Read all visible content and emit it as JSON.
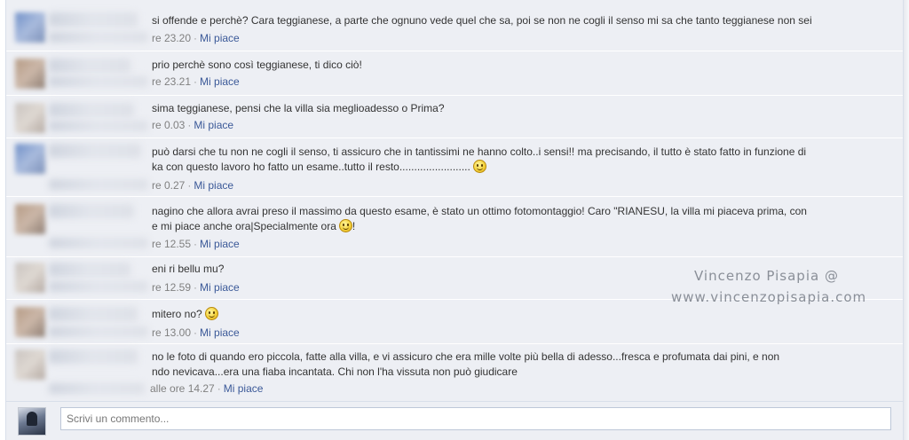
{
  "comments": [
    {
      "text_lines": [
        "si offende e perchè? Cara teggianese, a parte che ognuno vede quel che sa, poi se non ne cogli il senso mi sa che tanto teggianese non sei"
      ],
      "time": "re 23.20",
      "like": "Mi piace"
    },
    {
      "text_lines": [
        "prio perchè sono così teggianese, ti dico ciò!"
      ],
      "time": "re 23.21",
      "like": "Mi piace"
    },
    {
      "text_lines": [
        "sima teggianese, pensi che la villa sia meglioadesso o Prima?"
      ],
      "time": "re 0.03",
      "like": "Mi piace"
    },
    {
      "text_lines": [
        "può darsi che tu non ne cogli il senso, ti assicuro che in tantissimi ne hanno colto..i sensi!! ma precisando, il tutto è stato fatto in funzione di",
        "ka con questo lavoro ho fatto un esame..tutto il resto........................"
      ],
      "time": "re 0.27",
      "like": "Mi piace"
    },
    {
      "text_lines": [
        "nagino che allora avrai preso il massimo da questo esame, è stato un ottimo fotomontaggio! Caro \"RIANESU, la villa mi piaceva prima, con",
        "e mi piace anche ora|Specialmente ora",
        "!"
      ],
      "time": "re 12.55",
      "like": "Mi piace"
    },
    {
      "text_lines": [
        "eni ri bellu mu?"
      ],
      "time": "re 12.59",
      "like": "Mi piace"
    },
    {
      "text_lines": [
        "mitero no?"
      ],
      "time": "re 13.00",
      "like": "Mi piace"
    },
    {
      "text_lines": [
        "no le foto di quando ero piccola, fatte alla villa, e vi assicuro che era mille volte più bella di adesso...fresca e profumata dai pini, e non",
        "ndo nevicava...era una fiaba incantata. Chi non l'ha vissuta non può giudicare"
      ],
      "time": "alle ore 14.27",
      "like": "Mi piace"
    }
  ],
  "watermark": {
    "line1": "Vincenzo Pisapia @",
    "line2": "www.vincenzopisapia.com"
  },
  "reply": {
    "placeholder": "Scrivi un commento..."
  },
  "icons": {
    "smiley": "smiley-emoticon-icon",
    "dot": "·"
  },
  "colors": {
    "background": "#edeff4",
    "link": "#3b5998",
    "meta": "#808080",
    "watermark": "#8a8f98"
  }
}
